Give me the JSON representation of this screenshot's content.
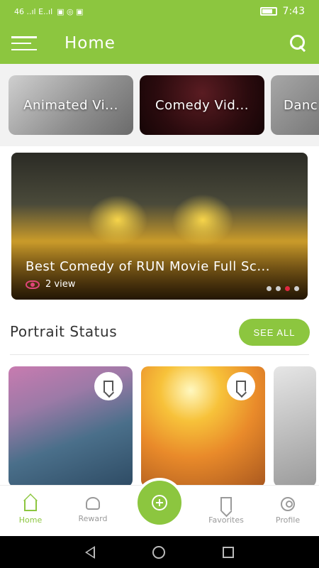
{
  "status_bar": {
    "left_text": "46 ..ıl  E..ıl",
    "time": "7:43"
  },
  "app_bar": {
    "title": "Home"
  },
  "categories": [
    {
      "label": "Animated Vi..."
    },
    {
      "label": "Comedy Vid..."
    },
    {
      "label": "Danc"
    }
  ],
  "banner": {
    "title": "Best Comedy of RUN Movie Full Sc...",
    "views": "2 view",
    "dots": 4,
    "active_dot": 2
  },
  "portrait_section": {
    "title": "Portrait Status",
    "see_all_label": "SEE ALL"
  },
  "bottom_nav": {
    "home": "Home",
    "reward": "Reward",
    "favorites": "Favorites",
    "profile": "Profile"
  },
  "colors": {
    "accent": "#8cc63f",
    "active_dot": "#e02840",
    "eye": "#e0457b"
  }
}
